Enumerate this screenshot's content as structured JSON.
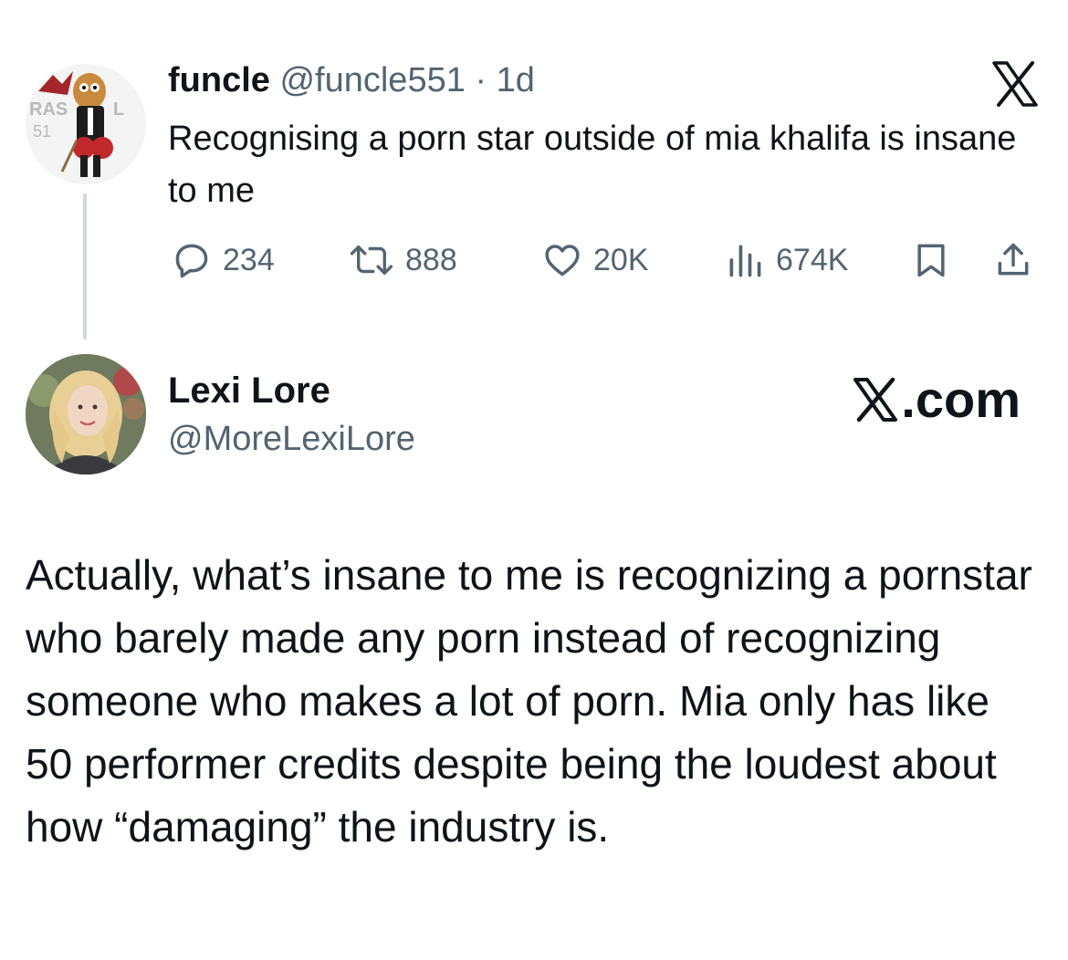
{
  "parent_tweet": {
    "display_name": "funcle",
    "handle": "@funcle551",
    "separator": "·",
    "time": "1d",
    "text": "Recognising a porn star outside of mia khalifa is insane to me",
    "stats": {
      "replies": "234",
      "reposts": "888",
      "likes": "20K",
      "views": "674K"
    },
    "icons": [
      "reply-icon",
      "repost-icon",
      "like-icon",
      "views-icon",
      "bookmark-icon",
      "share-icon"
    ],
    "avatar_text": "RAS 51 L"
  },
  "reply_tweet": {
    "display_name": "Lexi Lore",
    "handle": "@MoreLexiLore",
    "source_label": ".com",
    "text": "Actually, what’s insane to me is recognizing a pornstar who barely made any porn instead of recognizing someone who makes a lot of porn. Mia only has like 50 performer credits despite being the loudest about how “damaging” the industry is."
  },
  "colors": {
    "text_primary": "#0f1419",
    "text_secondary": "#536471",
    "thread_line": "#cfd9de"
  }
}
